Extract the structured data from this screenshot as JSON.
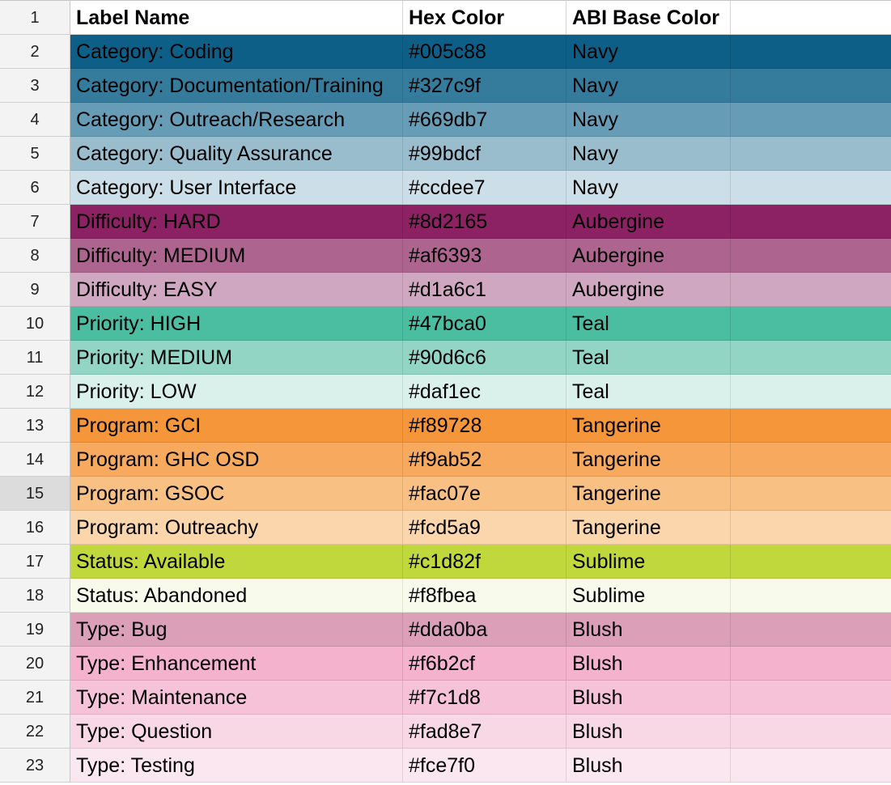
{
  "header": {
    "row_number": "1",
    "label_name": "Label Name",
    "hex_color": "Hex Color",
    "abi_base_color": "ABI Base Color"
  },
  "selected_row": "15",
  "rows": [
    {
      "num": "2",
      "label": "Category: Coding",
      "hex": "#005c88",
      "base": "Navy",
      "bg": "#0e5f87"
    },
    {
      "num": "3",
      "label": "Category: Documentation/Training",
      "hex": "#327c9f",
      "base": "Navy",
      "bg": "#357b9c"
    },
    {
      "num": "4",
      "label": "Category: Outreach/Research",
      "hex": "#669db7",
      "base": "Navy",
      "bg": "#669cb5"
    },
    {
      "num": "5",
      "label": "Category: Quality Assurance",
      "hex": "#99bdcf",
      "base": "Navy",
      "bg": "#9abdce"
    },
    {
      "num": "6",
      "label": "Category: User Interface",
      "hex": "#ccdee7",
      "base": "Navy",
      "bg": "#ccdee7"
    },
    {
      "num": "7",
      "label": "Difficulty: HARD",
      "hex": "#8d2165",
      "base": "Aubergine",
      "bg": "#8c2263"
    },
    {
      "num": "8",
      "label": "Difficulty: MEDIUM",
      "hex": "#af6393",
      "base": "Aubergine",
      "bg": "#ad6590"
    },
    {
      "num": "9",
      "label": "Difficulty: EASY",
      "hex": "#d1a6c1",
      "base": "Aubergine",
      "bg": "#d0a7c0"
    },
    {
      "num": "10",
      "label": "Priority: HIGH",
      "hex": "#47bca0",
      "base": "Teal",
      "bg": "#4bbda1"
    },
    {
      "num": "11",
      "label": "Priority: MEDIUM",
      "hex": "#90d6c6",
      "base": "Teal",
      "bg": "#92d5c5"
    },
    {
      "num": "12",
      "label": "Priority: LOW",
      "hex": "#daf1ec",
      "base": "Teal",
      "bg": "#daf1eb"
    },
    {
      "num": "13",
      "label": "Program: GCI",
      "hex": "#f89728",
      "base": "Tangerine",
      "bg": "#f6963a"
    },
    {
      "num": "14",
      "label": "Program: GHC OSD",
      "hex": "#f9ab52",
      "base": "Tangerine",
      "bg": "#f7aa5e"
    },
    {
      "num": "15",
      "label": "Program: GSOC",
      "hex": "#fac07e",
      "base": "Tangerine",
      "bg": "#f9c084"
    },
    {
      "num": "16",
      "label": "Program: Outreachy",
      "hex": "#fcd5a9",
      "base": "Tangerine",
      "bg": "#fbd5ab"
    },
    {
      "num": "17",
      "label": "Status: Available",
      "hex": "#c1d82f",
      "base": "Sublime",
      "bg": "#c1d83d"
    },
    {
      "num": "18",
      "label": "Status: Abandoned",
      "hex": "#f8fbea",
      "base": "Sublime",
      "bg": "#f8fbeb"
    },
    {
      "num": "19",
      "label": "Type: Bug",
      "hex": "#dda0ba",
      "base": "Blush",
      "bg": "#dba0b8"
    },
    {
      "num": "20",
      "label": "Type: Enhancement",
      "hex": "#f6b2cf",
      "base": "Blush",
      "bg": "#f4b2cd"
    },
    {
      "num": "21",
      "label": "Type: Maintenance",
      "hex": "#f7c1d8",
      "base": "Blush",
      "bg": "#f6c2d7"
    },
    {
      "num": "22",
      "label": "Type: Question",
      "hex": "#fad8e7",
      "base": "Blush",
      "bg": "#f9d8e6"
    },
    {
      "num": "23",
      "label": "Type: Testing",
      "hex": "#fce7f0",
      "base": "Blush",
      "bg": "#fbe7ef"
    }
  ]
}
